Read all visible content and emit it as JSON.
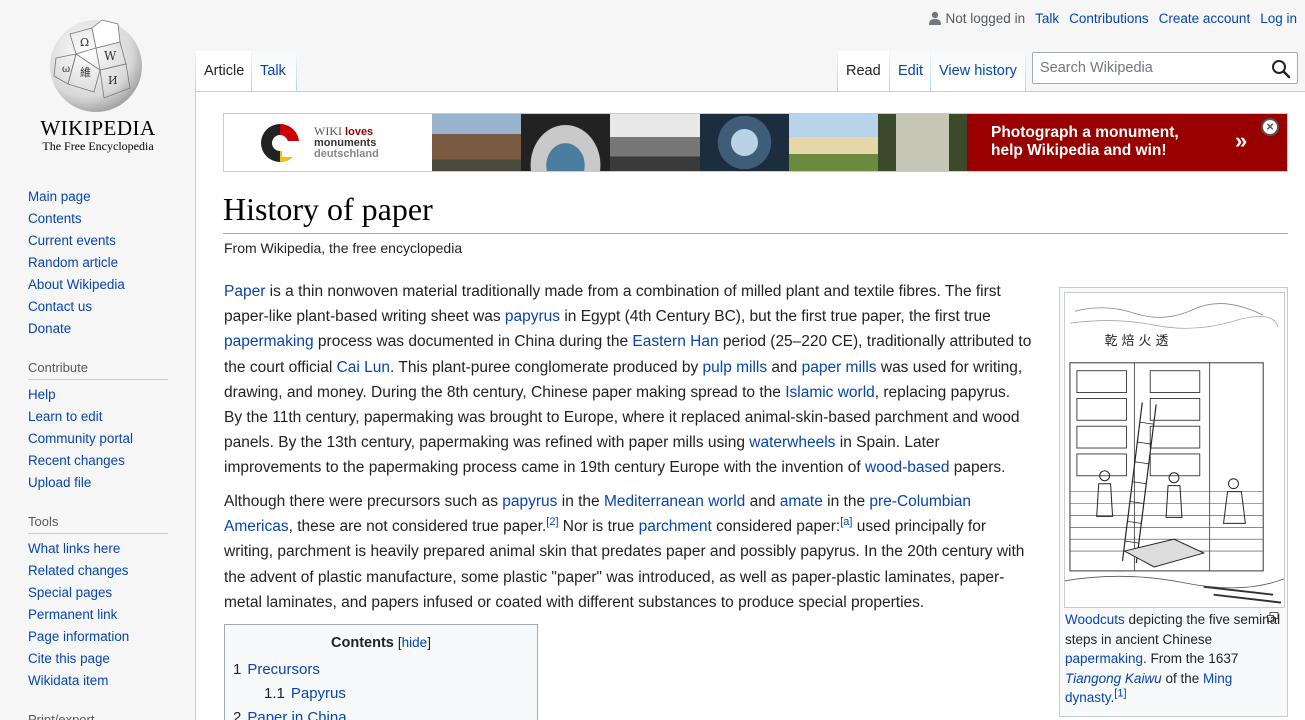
{
  "logo": {
    "wordmark": "WIKIPEDIA",
    "tagline": "The Free Encyclopedia"
  },
  "personal": {
    "not_logged_in": "Not logged in",
    "talk": "Talk",
    "contributions": "Contributions",
    "create_account": "Create account",
    "log_in": "Log in"
  },
  "tabs": {
    "article": "Article",
    "talk": "Talk",
    "read": "Read",
    "edit": "Edit",
    "view_history": "View history"
  },
  "search": {
    "placeholder": "Search Wikipedia"
  },
  "sidebar": {
    "navigation": [
      "Main page",
      "Contents",
      "Current events",
      "Random article",
      "About Wikipedia",
      "Contact us",
      "Donate"
    ],
    "contribute": {
      "heading": "Contribute",
      "items": [
        "Help",
        "Learn to edit",
        "Community portal",
        "Recent changes",
        "Upload file"
      ]
    },
    "tools": {
      "heading": "Tools",
      "items": [
        "What links here",
        "Related changes",
        "Special pages",
        "Permanent link",
        "Page information",
        "Cite this page",
        "Wikidata item"
      ]
    },
    "print": {
      "heading": "Print/export"
    }
  },
  "banner": {
    "wiki": "WIKI",
    "loves": "loves",
    "monuments": "monuments",
    "deutschland": "deutschland",
    "cta_line1": "Photograph a monument,",
    "cta_line2": "help Wikipedia and win!",
    "arrows": "»",
    "close": "×"
  },
  "article": {
    "title": "History of paper",
    "site_sub": "From Wikipedia, the free encyclopedia",
    "p1": [
      {
        "t": "Paper",
        "l": true
      },
      {
        "t": " is a thin nonwoven material traditionally made from a combination of milled plant and textile fibres. The first paper-like plant-based writing sheet was "
      },
      {
        "t": "papyrus",
        "l": true
      },
      {
        "t": " in Egypt (4th Century BC), but the first true paper, the first true "
      },
      {
        "t": "papermaking",
        "l": true
      },
      {
        "t": " process was documented in China during the "
      },
      {
        "t": "Eastern Han",
        "l": true
      },
      {
        "t": " period (25–220 CE), traditionally attributed to the court official "
      },
      {
        "t": "Cai Lun",
        "l": true
      },
      {
        "t": ". This plant-puree conglomerate produced by "
      },
      {
        "t": "pulp mills",
        "l": true
      },
      {
        "t": " and "
      },
      {
        "t": "paper mills",
        "l": true
      },
      {
        "t": " was used for writing, drawing, and money. During the 8th century, Chinese paper making spread to the "
      },
      {
        "t": "Islamic world",
        "l": true
      },
      {
        "t": ", replacing papyrus. By the 11th century, papermaking was brought to Europe, where it replaced animal-skin-based parchment and wood panels. By the 13th century, papermaking was refined with paper mills using "
      },
      {
        "t": "waterwheels",
        "l": true
      },
      {
        "t": " in Spain. Later improvements to the papermaking process came in 19th century Europe with the invention of "
      },
      {
        "t": "wood-based",
        "l": true
      },
      {
        "t": " papers."
      }
    ],
    "p2": [
      {
        "t": "Although there were precursors such as "
      },
      {
        "t": "papyrus",
        "l": true
      },
      {
        "t": " in the "
      },
      {
        "t": "Mediterranean world",
        "l": true
      },
      {
        "t": " and "
      },
      {
        "t": "amate",
        "l": true
      },
      {
        "t": " in the "
      },
      {
        "t": "pre-Columbian Americas",
        "l": true
      },
      {
        "t": ", these are not considered true paper."
      },
      {
        "t": "[2]",
        "l": true,
        "sup": true
      },
      {
        "t": " Nor is true "
      },
      {
        "t": "parchment",
        "l": true
      },
      {
        "t": " considered paper:"
      },
      {
        "t": "[a]",
        "l": true,
        "sup": true
      },
      {
        "t": " used principally for writing, parchment is heavily prepared animal skin that predates paper and possibly papyrus. In the 20th century with the advent of plastic manufacture, some plastic \"paper\" was introduced, as well as paper-plastic laminates, paper-metal laminates, and papers infused or coated with different substances to produce special properties."
      }
    ]
  },
  "thumb": {
    "caption": [
      {
        "t": "Woodcuts",
        "l": true
      },
      {
        "t": " depicting the five seminal steps in ancient Chinese "
      },
      {
        "t": "papermaking",
        "l": true
      },
      {
        "t": ". From the 1637 "
      },
      {
        "t": "Tiangong Kaiwu",
        "l": true,
        "i": true
      },
      {
        "t": " of the "
      },
      {
        "t": "Ming",
        "l": true
      },
      {
        "t": " dynasty",
        "l": true
      },
      {
        "t": "."
      },
      {
        "t": "[1]",
        "l": true,
        "sup": true
      }
    ],
    "chars": "乾 焙 火 透"
  },
  "toc": {
    "title": "Contents",
    "hide": "hide",
    "items": [
      {
        "num": "1",
        "label": "Precursors",
        "level": 1
      },
      {
        "num": "1.1",
        "label": "Papyrus",
        "level": 2
      },
      {
        "num": "2",
        "label": "Paper in China",
        "level": 1
      }
    ]
  },
  "colors": {
    "link": "#0645ad",
    "banner_red": "#990000",
    "border_blue": "#a7d7f9"
  }
}
